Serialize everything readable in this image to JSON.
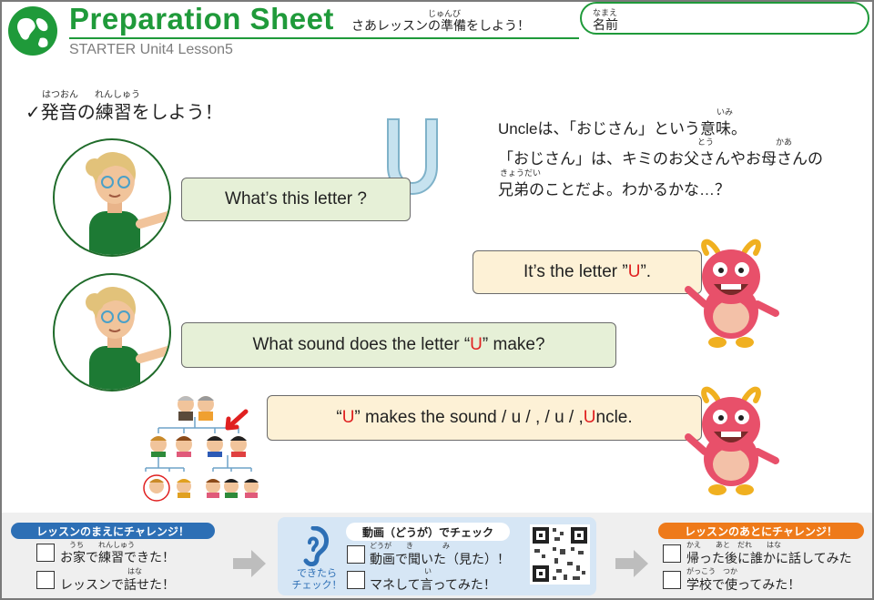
{
  "header": {
    "title": "Preparation Sheet",
    "title_sub": "さあレッスンの準備をしよう！",
    "title_sub_ruby": "じゅんび",
    "subtitle": "STARTER Unit4 Lesson5",
    "name_label": "名前",
    "name_ruby": "なまえ"
  },
  "section": {
    "check_mark": "✓",
    "heading": "発音の練習をしよう！",
    "heading_ruby_1": "はつおん",
    "heading_ruby_2": "れんしゅう"
  },
  "letter": "U",
  "explanation": {
    "line1": "Uncleは、「おじさん」という意味。",
    "line1_ruby": "いみ",
    "line2": "「おじさん」は、キミのお父さんやお母さんの",
    "line2_ruby_1": "とう",
    "line2_ruby_2": "かあ",
    "line3": "兄弟のことだよ。わかるかな…？",
    "line3_ruby": "きょうだい"
  },
  "dialogue": {
    "q1": "What’s this letter ?",
    "a1_pre": "It’s the letter ”",
    "a1_red": "U",
    "a1_post": "”.",
    "q2_pre": "What sound does the letter “",
    "q2_red": "U",
    "q2_post": "” make?",
    "a2_open": "“",
    "a2_red": "U",
    "a2_mid": "” makes the sound / u / , / u / , ",
    "a2_red2": "U",
    "a2_end": "ncle."
  },
  "bottom": {
    "before_title": "レッスンのまえにチャレンジ！",
    "before_items": [
      {
        "label": "お家で練習できた！",
        "ruby": "うち　　れんしゅう"
      },
      {
        "label": "レッスンで話せた！",
        "ruby": "はな"
      }
    ],
    "video_title": "動画（どうが）でチェック",
    "video_caption_1": "できたら",
    "video_caption_2": "チェック！",
    "video_items": [
      {
        "label": "動画で聞いた（見た）！",
        "ruby": "どうが　　き　　　　み"
      },
      {
        "label": "マネして言ってみた！",
        "ruby": "い"
      }
    ],
    "after_title": "レッスンのあとにチャレンジ！",
    "after_items": [
      {
        "label": "帰った後に誰かに話してみた",
        "ruby": "かえ　　あと　だれ　　はな"
      },
      {
        "label": "学校で使ってみた！",
        "ruby": "がっこう　つか"
      }
    ]
  },
  "colors": {
    "brand_green": "#1f9a3a",
    "letter_red": "#e02020",
    "bubble_green": "#e6f0d7",
    "bubble_cream": "#fdf1d6",
    "pill_blue": "#2d6fb5",
    "pill_orange": "#ee7a1a"
  }
}
